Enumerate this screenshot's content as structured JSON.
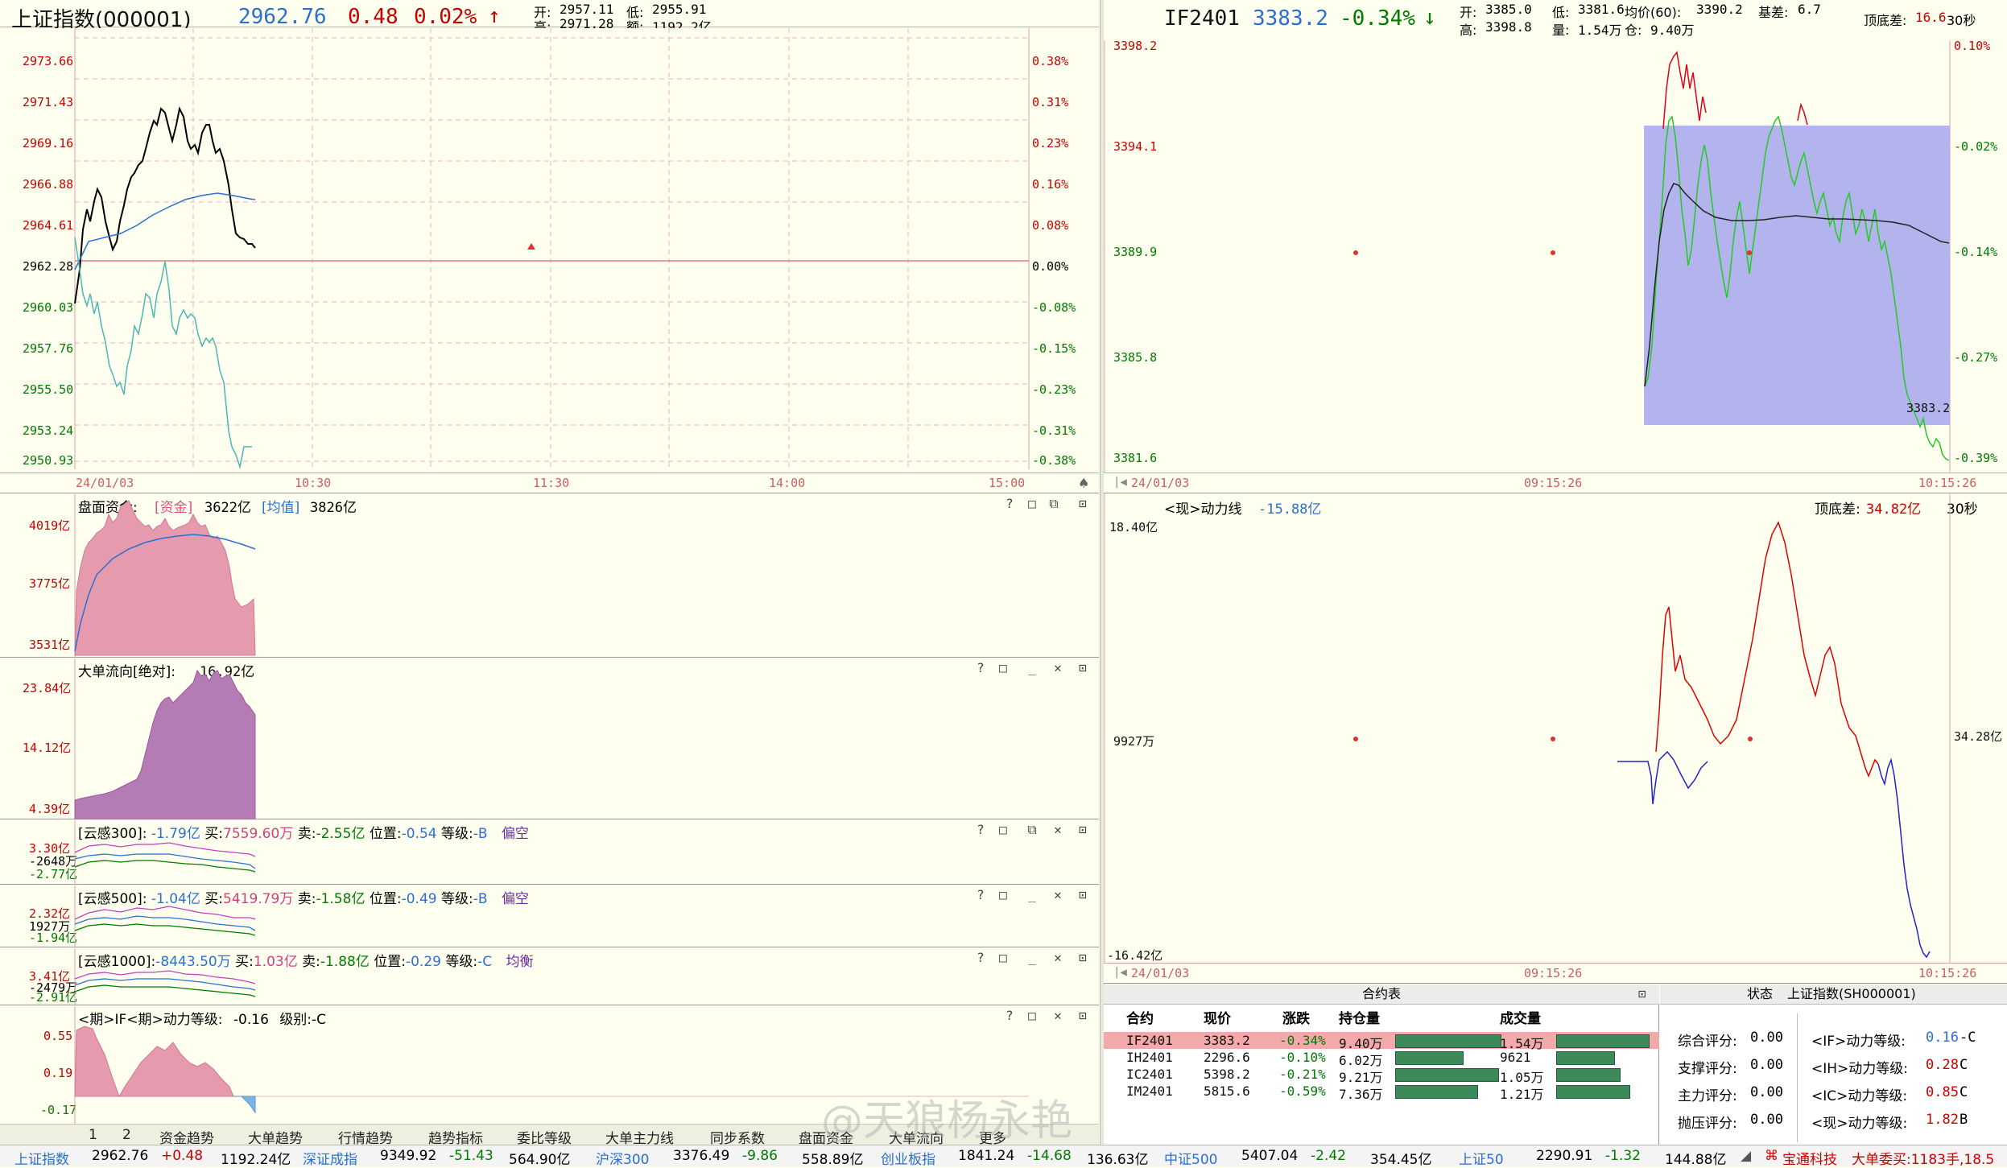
{
  "header": {
    "index_name": "上证指数(000001)",
    "price": "2962.76",
    "change": "0.48",
    "pct": "0.02%",
    "up_arrow": "↑",
    "open_label": "开:",
    "open": "2957.11",
    "low_label": "低:",
    "low": "2955.91",
    "high_label": "高:",
    "high": "2971.28",
    "amount_label": "额:",
    "amount": "1192.2亿"
  },
  "main_chart": {
    "y_left": [
      "2973.66",
      "2971.43",
      "2969.16",
      "2966.88",
      "2964.61",
      "2962.28",
      "2960.03",
      "2957.76",
      "2955.50",
      "2953.24",
      "2950.93"
    ],
    "y_right": [
      "0.38%",
      "0.31%",
      "0.23%",
      "0.16%",
      "0.08%",
      "0.00%",
      "-0.08%",
      "-0.15%",
      "-0.23%",
      "-0.31%",
      "-0.38%"
    ],
    "x_labels": [
      "24/01/03",
      "10:30",
      "11:30",
      "14:00",
      "15:00"
    ]
  },
  "panel_fund": {
    "title": "盘面资金:",
    "tag1": "[资金]",
    "val1": "3622亿",
    "tag2": "[均值]",
    "val2": "3826亿",
    "y": [
      "4019亿",
      "3775亿",
      "3531亿"
    ]
  },
  "panel_big": {
    "title": "大单流向[绝对]:",
    "val": "16.92亿",
    "y": [
      "23.84亿",
      "14.12亿",
      "4.39亿"
    ]
  },
  "panel_y300": {
    "name": "[云感300]:",
    "v1": "-1.79亿",
    "buy_l": "买:",
    "buy": "7559.60万",
    "sell_l": "卖:",
    "sell": "-2.55亿",
    "pos_l": "位置:",
    "pos": "-0.54",
    "lvl_l": "等级:",
    "lvl": "-B",
    "state": "偏空",
    "y": [
      "3.30亿",
      "-2648万",
      "-2.77亿"
    ]
  },
  "panel_y500": {
    "name": "[云感500]:",
    "v1": "-1.04亿",
    "buy_l": "买:",
    "buy": "5419.79万",
    "sell_l": "卖:",
    "sell": "-1.58亿",
    "pos_l": "位置:",
    "pos": "-0.49",
    "lvl_l": "等级:",
    "lvl": "-B",
    "state": "偏空",
    "y": [
      "2.32亿",
      "1927万",
      "-1.94亿"
    ]
  },
  "panel_y1000": {
    "name": "[云感1000]:",
    "v1": "-8443.50万",
    "buy_l": "买:",
    "buy": "1.03亿",
    "sell_l": "卖:",
    "sell": "-1.88亿",
    "pos_l": "位置:",
    "pos": "-0.29",
    "lvl_l": "等级:",
    "lvl": "-C",
    "state": "均衡",
    "y": [
      "3.41亿",
      "-2479万",
      "-2.91亿"
    ]
  },
  "panel_power": {
    "title": "<期>IF<期>动力等级:",
    "val": "-0.16",
    "lvl_l": "级别:",
    "lvl": "-C",
    "y": [
      "0.55",
      "0.19",
      "-0.17"
    ]
  },
  "tabs": [
    "1",
    "2",
    "资金趋势",
    "大单趋势",
    "行情趋势",
    "趋势指标",
    "委比等级",
    "大单主力线",
    "同步系数",
    "盘面资金",
    "大单流向",
    "更多"
  ],
  "futures": {
    "code": "IF2401",
    "price": "3383.2",
    "pct": "-0.34%",
    "down_arrow": "↓",
    "open_label": "开:",
    "open": "3385.0",
    "low_label": "低:",
    "low": "3381.6",
    "avg_label": "均价(60):",
    "avg": "3390.2",
    "basis_label": "基差:",
    "basis": "6.7",
    "high_label": "高:",
    "high": "3398.8",
    "vol_label": "量:",
    "vol": "1.54万",
    "oi_label": "仓:",
    "oi": "9.40万",
    "tb_label": "顶底差:",
    "tb": "16.6",
    "period": "30秒",
    "y_left": [
      "3398.2",
      "3394.1",
      "3389.9",
      "3385.8",
      "3381.6"
    ],
    "y_right": [
      "0.10%",
      "-0.02%",
      "-0.14%",
      "-0.27%",
      "-0.39%"
    ],
    "last_label": "3383.2",
    "x_labels": [
      "24/01/03",
      "09:15:26",
      "10:15:26"
    ]
  },
  "power_line": {
    "title": "<现>动力线",
    "val": "-15.88亿",
    "tb_label": "顶底差:",
    "tb": "34.82亿",
    "period": "30秒",
    "y_left": [
      "18.40亿",
      "9927万",
      "-16.42亿"
    ],
    "y_right": "34.28亿",
    "x_labels": [
      "24/01/03",
      "09:15:26",
      "10:15:26"
    ]
  },
  "contract_table": {
    "title": "合约表",
    "headers": [
      "合约",
      "现价",
      "涨跌",
      "持仓量",
      "成交量"
    ],
    "rows": [
      {
        "code": "IF2401",
        "price": "3383.2",
        "chg": "-0.34%",
        "oi": "9.40万",
        "vol": "1.54万",
        "oi_bar": 1.0,
        "vol_bar": 0.95
      },
      {
        "code": "IH2401",
        "price": "2296.6",
        "chg": "-0.10%",
        "oi": "6.02万",
        "vol": "9621",
        "oi_bar": 0.64,
        "vol_bar": 0.59
      },
      {
        "code": "IC2401",
        "price": "5398.2",
        "chg": "-0.21%",
        "oi": "9.21万",
        "vol": "1.05万",
        "oi_bar": 0.98,
        "vol_bar": 0.65
      },
      {
        "code": "IM2401",
        "price": "5815.6",
        "chg": "-0.59%",
        "oi": "7.36万",
        "vol": "1.21万",
        "oi_bar": 0.78,
        "vol_bar": 0.75
      }
    ]
  },
  "status_panel": {
    "title": "状态",
    "subject": "上证指数(SH000001)",
    "scores": [
      {
        "label": "综合评分:",
        "val": "0.00"
      },
      {
        "label": "支撑评分:",
        "val": "0.00"
      },
      {
        "label": "主力评分:",
        "val": "0.00"
      },
      {
        "label": "抛压评分:",
        "val": "0.00"
      }
    ],
    "levels": [
      {
        "label": "<IF>动力等级:",
        "val": "0.16",
        "lvl": "-C"
      },
      {
        "label": "<IH>动力等级:",
        "val": "0.28",
        "lvl": "C"
      },
      {
        "label": "<IC>动力等级:",
        "val": "0.85",
        "lvl": "C"
      },
      {
        "label": "<现>动力等级:",
        "val": "1.82",
        "lvl": "B"
      }
    ]
  },
  "statusbar": [
    {
      "name": "上证指数",
      "v1": "2962.76",
      "v2": "+0.48",
      "v3": "1192.24亿"
    },
    {
      "name": "深证成指",
      "v1": "9349.92",
      "v2": "-51.43",
      "v3": "564.90亿"
    },
    {
      "name": "沪深300",
      "v1": "3376.49",
      "v2": "-9.86",
      "v3": "558.89亿"
    },
    {
      "name": "创业板指",
      "v1": "1841.24",
      "v2": "-14.68",
      "v3": "136.63亿"
    },
    {
      "name": "中证500",
      "v1": "5407.04",
      "v2": "-2.42",
      "v3": "354.45亿"
    },
    {
      "name": "上证50",
      "v1": "2290.91",
      "v2": "-1.32",
      "v3": "144.88亿"
    }
  ],
  "statusbar_right": {
    "brand": "宝通科技",
    "big": "大单委买:1183手,18.5"
  },
  "watermark": "@天狼杨永艳",
  "colors": {
    "up": "#c80000",
    "down": "#007a00",
    "blue": "#2b6fd0",
    "pink": "#e59aae",
    "purple": "#b57bb5",
    "lavender": "#b3b3ee"
  }
}
